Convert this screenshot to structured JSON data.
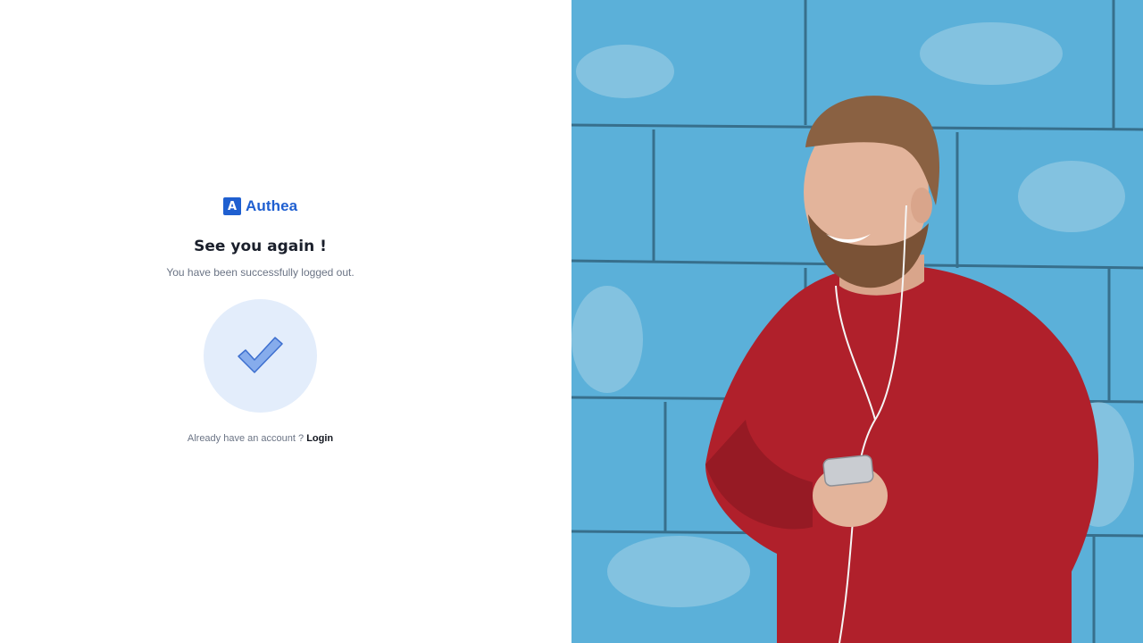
{
  "brand": {
    "mark": "A",
    "name": "Authea"
  },
  "main": {
    "title": "See you again !",
    "subtitle": "You have been successfully logged out.",
    "success_icon": "checkmark-icon",
    "footer_prompt": "Already have an account ? ",
    "login_label": "Login"
  },
  "colors": {
    "brand": "#1f5fd0",
    "circle_bg": "#e3edfb",
    "check_fill": "#86acec",
    "check_stroke": "#3d6fcf",
    "wall": "#5bb0d9",
    "sweater": "#b0202b"
  }
}
